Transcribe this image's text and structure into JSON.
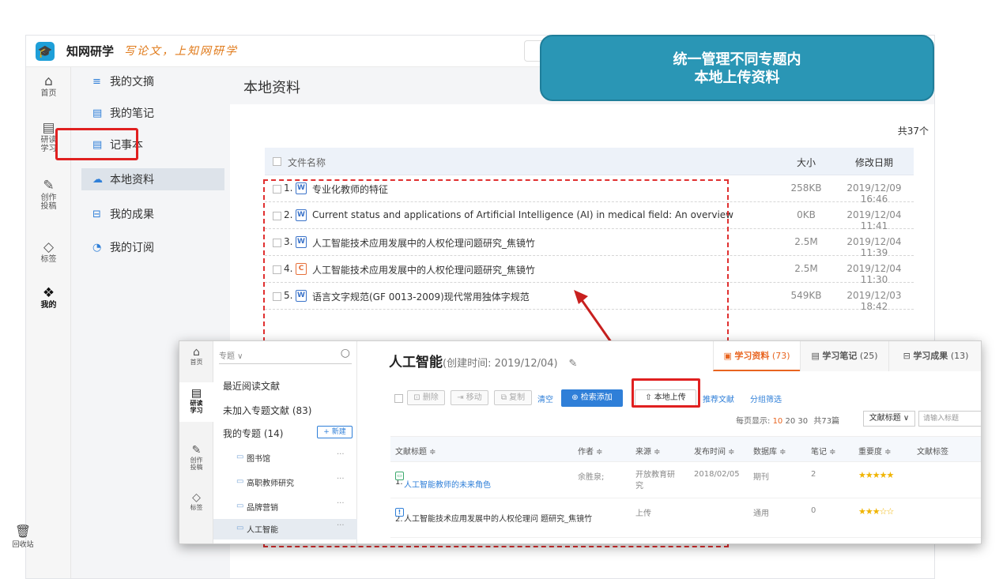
{
  "app": {
    "brand": "知网研学",
    "slogan": "写论文，上知网研学",
    "logo_icon": "graduation-cap-icon"
  },
  "rail": [
    {
      "label": "首页",
      "icon": "⌂"
    },
    {
      "label": "研读\n学习",
      "icon": "▤"
    },
    {
      "label": "创作\n投稿",
      "icon": "✎"
    },
    {
      "label": "标签",
      "icon": "◇"
    },
    {
      "label": "我的",
      "icon": "❖"
    }
  ],
  "trash": {
    "label": "回收站",
    "icon": "🗑"
  },
  "nav2": [
    {
      "label": "我的文摘",
      "icon": "≡"
    },
    {
      "label": "我的笔记",
      "icon": "▤"
    },
    {
      "label": "记事本",
      "icon": "▤"
    },
    {
      "label": "本地资料",
      "icon": "☁"
    },
    {
      "label": "我的成果",
      "icon": "⊟"
    },
    {
      "label": "我的订阅",
      "icon": "◔"
    }
  ],
  "main": {
    "title": "本地资料",
    "total": "共37个",
    "columns": {
      "name": "文件名称",
      "size": "大小",
      "date": "修改日期"
    },
    "rows": [
      {
        "num": "1.",
        "type": "W",
        "name": "专业化教师的特征",
        "size": "258KB",
        "date": "2019/12/09 16:46"
      },
      {
        "num": "2.",
        "type": "W",
        "name": "Current status and applications of Artificial Intelligence (AI) in medical field: An overview",
        "size": "0KB",
        "date": "2019/12/04 11:41"
      },
      {
        "num": "3.",
        "type": "W",
        "name": "人工智能技术应用发展中的人权伦理问题研究_焦镜竹",
        "size": "2.5M",
        "date": "2019/12/04 11:39"
      },
      {
        "num": "4.",
        "type": "C",
        "name": "人工智能技术应用发展中的人权伦理问题研究_焦镜竹",
        "size": "2.5M",
        "date": "2019/12/04 11:30"
      },
      {
        "num": "5.",
        "type": "W",
        "name": "语言文字规范(GF 0013-2009)现代常用独体字规范",
        "size": "549KB",
        "date": "2019/12/03 18:42"
      }
    ]
  },
  "callout": {
    "line1": "统一管理不同专题内",
    "line2": "本地上传资料"
  },
  "inner": {
    "rail": [
      {
        "label": "首页",
        "icon": "⌂"
      },
      {
        "label": "研读\n学习",
        "icon": "▤"
      },
      {
        "label": "创作\n投稿",
        "icon": "✎"
      },
      {
        "label": "标签",
        "icon": "◇"
      }
    ],
    "search_placeholder": "专题 ∨",
    "recent": "最近阅读文献",
    "unadded": "未加入专题文献 (83)",
    "my_topics": "我的专题 (14)",
    "new_btn": "+ 新建",
    "folders": [
      "图书馆",
      "高职教师研究",
      "品牌营销",
      "人工智能"
    ],
    "title": "人工智能",
    "title_sub": "(创建时间: 2019/12/04)",
    "tabs": [
      {
        "label": "学习资料",
        "count": "(73)"
      },
      {
        "label": "学习笔记",
        "count": "(25)"
      },
      {
        "label": "学习成果",
        "count": "(13)"
      }
    ],
    "toolbar": {
      "delete": "删除",
      "move": "移动",
      "copy": "复制",
      "clear": "清空",
      "search_add": "检索添加",
      "upload": "本地上传",
      "recommend": "推荐文献",
      "group_filter": "分组筛选"
    },
    "page_info": {
      "prefix": "每页显示:",
      "opts": [
        "10",
        "20",
        "30"
      ],
      "total": "共73篇",
      "sort": "文献标题 ∨",
      "input_placeholder": "请输入标题"
    },
    "columns": [
      "文献标题 ≑",
      "作者 ≑",
      "来源 ≑",
      "发布时间 ≑",
      "数据库 ≑",
      "笔记 ≑",
      "重要度 ≑",
      "文献标签"
    ],
    "rows": [
      {
        "num": "1.",
        "title": "人工智能教师的未来角色",
        "author": "余胜泉;",
        "source": "开放教育研\n究",
        "date": "2018/02/05",
        "db": "期刊",
        "notes": "2",
        "stars": "★★★★★"
      },
      {
        "num": "2.",
        "title": "人工智能技术应用发展中的人权伦理问\n题研究_焦镜竹",
        "author": "",
        "source": "上传",
        "date": "",
        "db": "通用",
        "notes": "0",
        "stars": "★★★☆☆"
      }
    ]
  }
}
